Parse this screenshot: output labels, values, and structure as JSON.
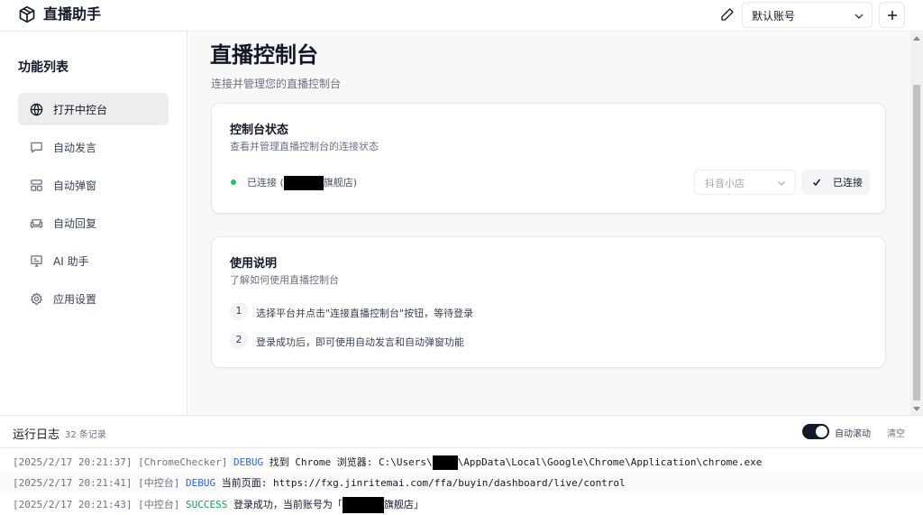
{
  "app": {
    "title": "直播助手",
    "icon": "package-icon"
  },
  "header": {
    "account_select": "默认账号",
    "edit_icon": "pencil-icon",
    "add_icon": "plus-icon"
  },
  "sidebar": {
    "title": "功能列表",
    "items": [
      {
        "label": "打开中控台",
        "icon": "globe-icon",
        "active": true
      },
      {
        "label": "自动发言",
        "icon": "message-icon",
        "active": false
      },
      {
        "label": "自动弹窗",
        "icon": "layout-icon",
        "active": false
      },
      {
        "label": "自动回复",
        "icon": "sofa-icon",
        "active": false
      },
      {
        "label": "AI 助手",
        "icon": "monitor-icon",
        "active": false
      },
      {
        "label": "应用设置",
        "icon": "gear-icon",
        "active": false
      }
    ]
  },
  "main": {
    "title": "直播控制台",
    "subtitle": "连接并管理您的直播控制台",
    "status_card": {
      "title": "控制台状态",
      "subtitle": "查看并管理直播控制台的连接状态",
      "status_prefix": "已连接 (",
      "status_suffix": "旗舰店)",
      "platform_select": "抖音小店",
      "connected_button": "已连接"
    },
    "guide_card": {
      "title": "使用说明",
      "subtitle": "了解如何使用直播控制台",
      "steps": [
        {
          "num": "1",
          "text": "选择平台并点击\"连接直播控制台\"按钮，等待登录"
        },
        {
          "num": "2",
          "text": "登录成功后，即可使用自动发言和自动弹窗功能"
        }
      ]
    }
  },
  "log": {
    "title": "运行日志",
    "count": "32 条记录",
    "auto_scroll_label": "自动滚动",
    "auto_scroll_on": true,
    "clear_label": "清空",
    "lines": [
      {
        "ts": "[2025/2/17 20:21:37]",
        "src": "[ChromeChecker]",
        "level": "DEBUG",
        "msg_a": "找到 Chrome 浏览器: C:\\Users\\",
        "msg_b": "\\AppData\\Local\\Google\\Chrome\\Application\\chrome.exe"
      },
      {
        "ts": "[2025/2/17 20:21:41]",
        "src": "[中控台]",
        "level": "DEBUG",
        "msg_a": "当前页面: https://fxg.jinritemai.com/ffa/buyin/dashboard/live/control",
        "msg_b": ""
      },
      {
        "ts": "[2025/2/17 20:21:43]",
        "src": "[中控台]",
        "level": "SUCCESS",
        "msg_a": "登录成功，当前账号为「",
        "msg_b": "旗舰店」"
      }
    ]
  },
  "colors": {
    "accent": "#111827",
    "success": "#22c55e",
    "debug": "#2563eb",
    "success_text": "#16a34a",
    "main_bg": "#f8f8f9"
  }
}
